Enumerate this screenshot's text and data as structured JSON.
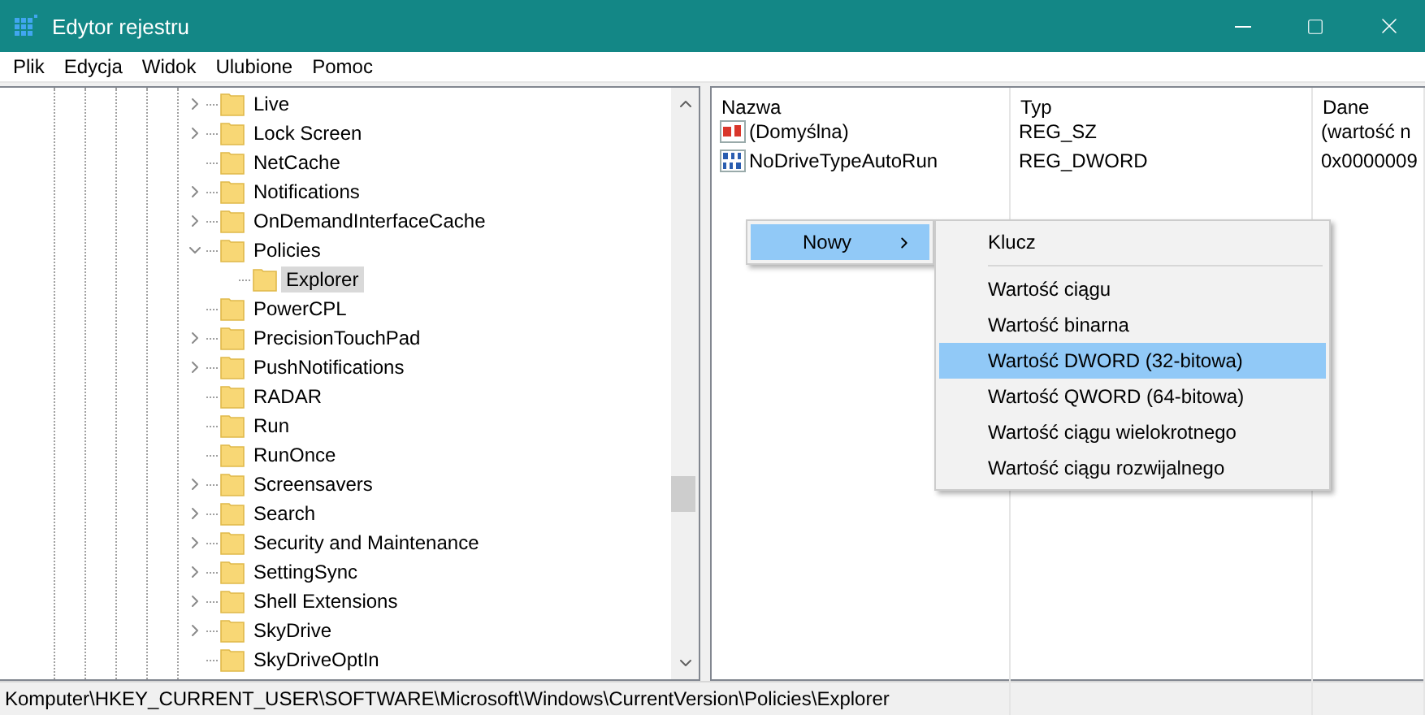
{
  "window": {
    "title": "Edytor rejestru"
  },
  "menu_bar": [
    "Plik",
    "Edycja",
    "Widok",
    "Ulubione",
    "Pomoc"
  ],
  "tree": {
    "items": [
      {
        "label": "Live",
        "kind": "node",
        "expanded": false,
        "selected": false
      },
      {
        "label": "Lock Screen",
        "kind": "node",
        "expanded": false,
        "selected": false
      },
      {
        "label": "NetCache",
        "kind": "leaf",
        "selected": false
      },
      {
        "label": "Notifications",
        "kind": "node",
        "expanded": false,
        "selected": false
      },
      {
        "label": "OnDemandInterfaceCache",
        "kind": "node",
        "expanded": false,
        "selected": false
      },
      {
        "label": "Policies",
        "kind": "node",
        "expanded": true,
        "selected": false,
        "children": [
          {
            "label": "Explorer",
            "kind": "leaf",
            "selected": true
          }
        ]
      },
      {
        "label": "PowerCPL",
        "kind": "leaf",
        "selected": false
      },
      {
        "label": "PrecisionTouchPad",
        "kind": "node",
        "expanded": false,
        "selected": false
      },
      {
        "label": "PushNotifications",
        "kind": "node",
        "expanded": false,
        "selected": false
      },
      {
        "label": "RADAR",
        "kind": "leaf",
        "selected": false
      },
      {
        "label": "Run",
        "kind": "leaf",
        "selected": false
      },
      {
        "label": "RunOnce",
        "kind": "leaf",
        "selected": false
      },
      {
        "label": "Screensavers",
        "kind": "node",
        "expanded": false,
        "selected": false
      },
      {
        "label": "Search",
        "kind": "node",
        "expanded": false,
        "selected": false
      },
      {
        "label": "Security and Maintenance",
        "kind": "node",
        "expanded": false,
        "selected": false
      },
      {
        "label": "SettingSync",
        "kind": "node",
        "expanded": false,
        "selected": false
      },
      {
        "label": "Shell Extensions",
        "kind": "node",
        "expanded": false,
        "selected": false
      },
      {
        "label": "SkyDrive",
        "kind": "node",
        "expanded": false,
        "selected": false
      },
      {
        "label": "SkyDriveOptIn",
        "kind": "leaf",
        "selected": false
      }
    ]
  },
  "values": {
    "columns": [
      "Nazwa",
      "Typ",
      "Dane"
    ],
    "rows": [
      {
        "kind": "string",
        "name": "(Domyślna)",
        "type": "REG_SZ",
        "data": "(wartość n"
      },
      {
        "kind": "binary",
        "name": "NoDriveTypeAutoRun",
        "type": "REG_DWORD",
        "data": "0x0000009"
      }
    ]
  },
  "context_menu": {
    "items": [
      {
        "label": "Nowy",
        "selected": true
      }
    ]
  },
  "submenu": {
    "items": [
      {
        "kind": "item",
        "label": "Klucz",
        "selected": false
      },
      {
        "kind": "separator"
      },
      {
        "kind": "item",
        "label": "Wartość ciągu",
        "selected": false
      },
      {
        "kind": "item",
        "label": "Wartość binarna",
        "selected": false
      },
      {
        "kind": "item",
        "label": "Wartość DWORD (32-bitowa)",
        "selected": true
      },
      {
        "kind": "item",
        "label": "Wartość QWORD (64-bitowa)",
        "selected": false
      },
      {
        "kind": "item",
        "label": "Wartość ciągu wielokrotnego",
        "selected": false
      },
      {
        "kind": "item",
        "label": "Wartość ciągu rozwijalnego",
        "selected": false
      }
    ]
  },
  "status_bar": "Komputer\\HKEY_CURRENT_USER\\SOFTWARE\\Microsoft\\Windows\\CurrentVersion\\Policies\\Explorer"
}
